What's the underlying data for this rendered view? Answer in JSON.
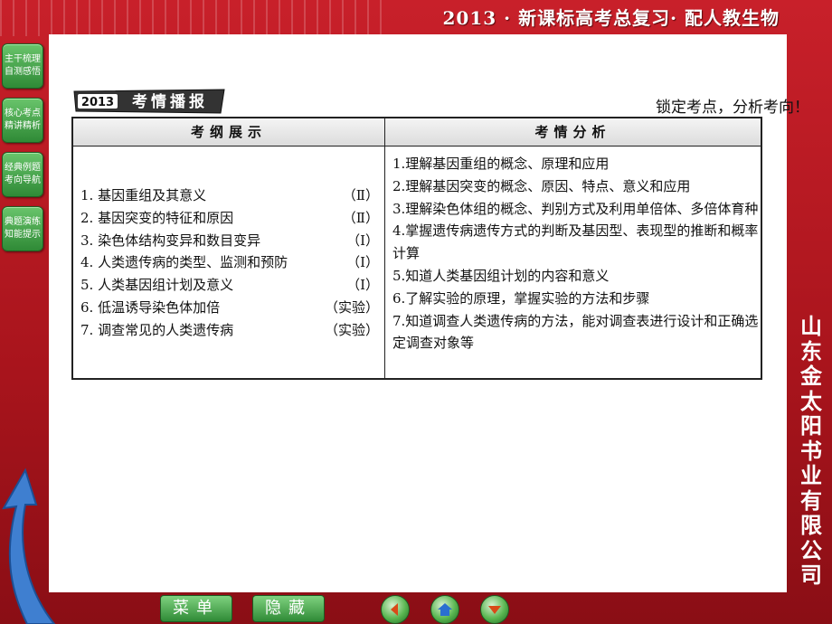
{
  "header": {
    "title": "2013 · 新课标高考总复习· 配人教生物"
  },
  "sidebar": [
    {
      "line1": "主干梳理",
      "line2": "自测感悟"
    },
    {
      "line1": "核心考点",
      "line2": "精讲精析"
    },
    {
      "line1": "经典例题",
      "line2": "考向导航"
    },
    {
      "line1": "典题演练",
      "line2": "知能提示"
    }
  ],
  "publisher": [
    "山",
    "东",
    "金",
    "太",
    "阳",
    "书",
    "业",
    "有",
    "限",
    "公",
    "司"
  ],
  "banner": {
    "year": "2013",
    "text": "考情播报"
  },
  "tagline": "锁定考点，分析考向！",
  "table": {
    "col1_header": "考纲展示",
    "col2_header": "考情分析",
    "left_items": [
      {
        "text": "1. 基因重组及其意义",
        "level": "（Ⅱ）"
      },
      {
        "text": "2. 基因突变的特征和原因",
        "level": "（Ⅱ）"
      },
      {
        "text": "3. 染色体结构变异和数目变异",
        "level": "（Ⅰ）"
      },
      {
        "text": "4. 人类遗传病的类型、监测和预防",
        "level": "（Ⅰ）"
      },
      {
        "text": "5. 人类基因组计划及意义",
        "level": "（Ⅰ）"
      },
      {
        "text": "6. 低温诱导染色体加倍",
        "level": "（实验）"
      },
      {
        "text": "7. 调查常见的人类遗传病",
        "level": "（实验）"
      }
    ],
    "right_items": [
      "1.理解基因重组的概念、原理和应用",
      "2.理解基因突变的概念、原因、特点、意义和应用",
      "3.理解染色体组的概念、判别方式及利用单倍体、多倍体育种",
      "4.掌握遗传病遗传方式的判断及基因型、表现型的推断和概率计算",
      "5.知道人类基因组计划的内容和意义",
      "6.了解实验的原理，掌握实验的方法和步骤",
      "7.知道调查人类遗传病的方法，能对调查表进行设计和正确选定调查对象等"
    ]
  },
  "bottom": {
    "menu_label": "菜单",
    "hide_label": "隐藏"
  }
}
